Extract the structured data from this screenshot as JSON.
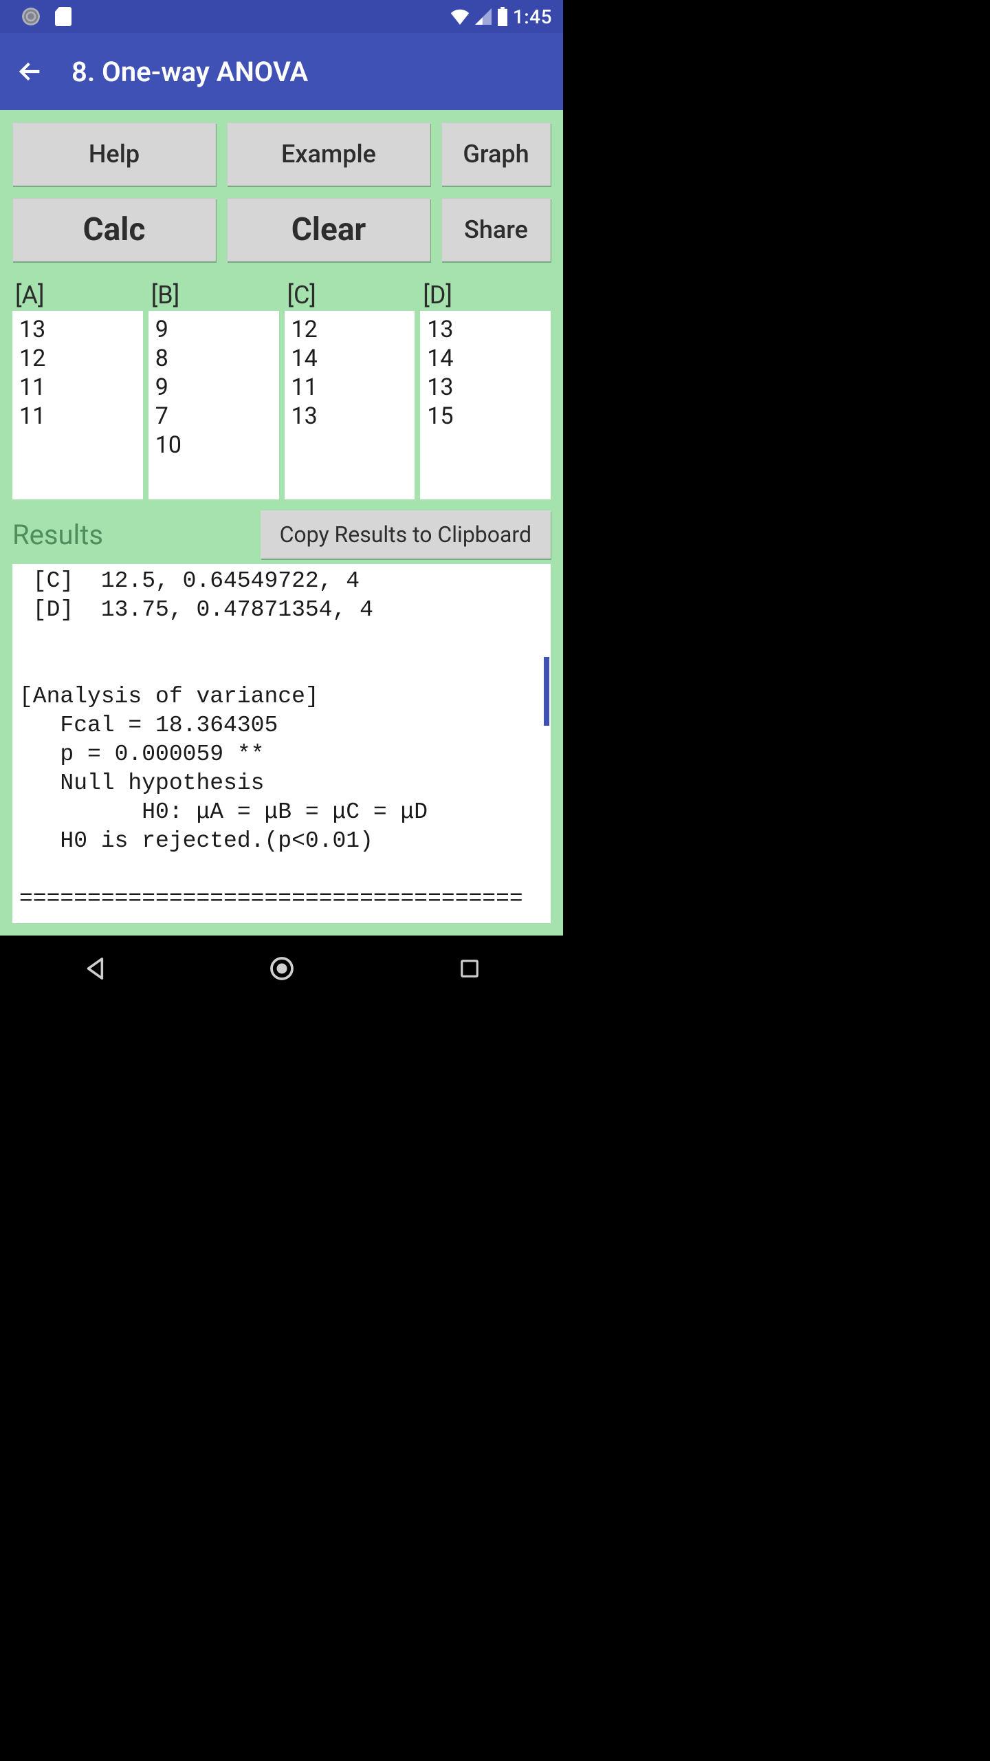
{
  "statusbar": {
    "time": "1:45"
  },
  "appbar": {
    "title": "8. One-way ANOVA"
  },
  "buttons": {
    "help": "Help",
    "example": "Example",
    "graph": "Graph",
    "calc": "Calc",
    "clear": "Clear",
    "share": "Share"
  },
  "columns": {
    "headers": {
      "a": "[A]",
      "b": "[B]",
      "c": "[C]",
      "d": "[D]"
    },
    "data": {
      "a": "13\n12\n11\n11",
      "b": "9\n8\n9\n7\n10",
      "c": "12\n14\n11\n13",
      "d": "13\n14\n13\n15"
    }
  },
  "results": {
    "label": "Results",
    "copy_button": "Copy Results to Clipboard",
    "text": " [C]  12.5, 0.64549722, 4\n [D]  13.75, 0.47871354, 4\n\n\n[Analysis of variance]\n   Fcal = 18.364305\n   p = 0.000059 **\n   Null hypothesis\n         H0: μA = μB = μC = μD\n   H0 is rejected.(p<0.01)\n\n====================================="
  }
}
